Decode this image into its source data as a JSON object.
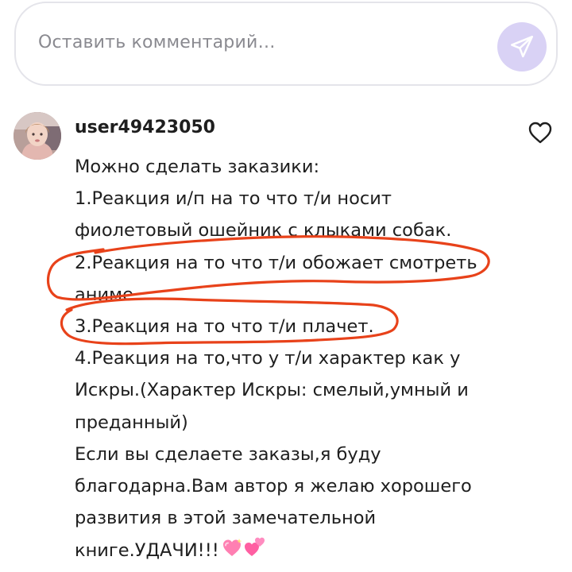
{
  "comment_bar": {
    "placeholder": "Оставить комментарий…",
    "send_icon": "paper-plane-icon",
    "accent_color": "#d9d2f5"
  },
  "comment": {
    "username": "user49423050",
    "avatar": "user-avatar",
    "like_icon": "heart-outline-icon",
    "lines": [
      "Можно сделать заказики:",
      "1.Реакция и/п на то что т/и носит",
      "фиолетовый ошейник с клыками собак.",
      "2.Реакция на то что т/и обожает смотреть",
      "аниме.",
      "3.Реакция на то что т/и плачет.",
      "4.Реакция на то,что у т/и характер как у",
      "Искры.(Характер Искры: смелый,умный и",
      "преданный)",
      "Если вы сделаете заказы,я буду",
      "благодарна.Вам автор я желаю хорошего",
      "развития в этой замечательной",
      "книге.УДАЧИ!!!"
    ],
    "emoji_icons": [
      "sparkling-heart-emoji",
      "two-hearts-emoji"
    ]
  },
  "annotations": {
    "color": "#e8421a",
    "circled_lines": [
      "2",
      "3"
    ]
  }
}
